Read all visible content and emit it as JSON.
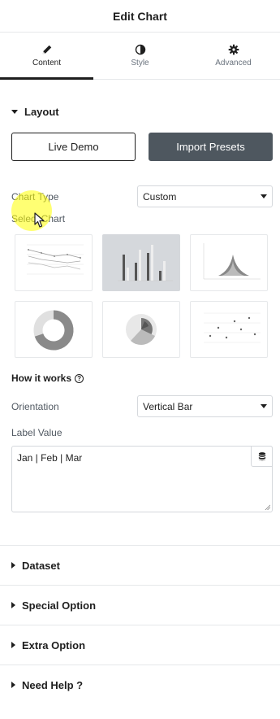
{
  "header": {
    "title": "Edit Chart"
  },
  "tabs": [
    {
      "label": "Content",
      "icon": "pencil-icon",
      "active": true
    },
    {
      "label": "Style",
      "icon": "half-circle-icon",
      "active": false
    },
    {
      "label": "Advanced",
      "icon": "gear-icon",
      "active": false
    }
  ],
  "layout": {
    "title": "Layout",
    "live_demo_label": "Live Demo",
    "import_presets_label": "Import Presets",
    "chart_type_label": "Chart Type",
    "chart_type_value": "Custom",
    "select_chart_label": "Select Chart",
    "chart_options": [
      {
        "icon": "line-chart-thumb-icon",
        "selected": false
      },
      {
        "icon": "bar-chart-thumb-icon",
        "selected": true
      },
      {
        "icon": "radar-chart-thumb-icon",
        "selected": false
      },
      {
        "icon": "doughnut-chart-thumb-icon",
        "selected": false
      },
      {
        "icon": "polar-chart-thumb-icon",
        "selected": false
      },
      {
        "icon": "scatter-chart-thumb-icon",
        "selected": false
      }
    ],
    "how_it_works_label": "How it works",
    "orientation_label": "Orientation",
    "orientation_value": "Vertical Bar",
    "label_value_label": "Label Value",
    "label_value_text": "Jan | Feb | Mar"
  },
  "sections": [
    {
      "title": "Dataset"
    },
    {
      "title": "Special Option"
    },
    {
      "title": "Extra Option"
    },
    {
      "title": "Need Help ?"
    }
  ],
  "colors": {
    "dark_button": "#4e575f",
    "border": "#d5d8dc",
    "cursor_highlight": "#ffff00"
  }
}
